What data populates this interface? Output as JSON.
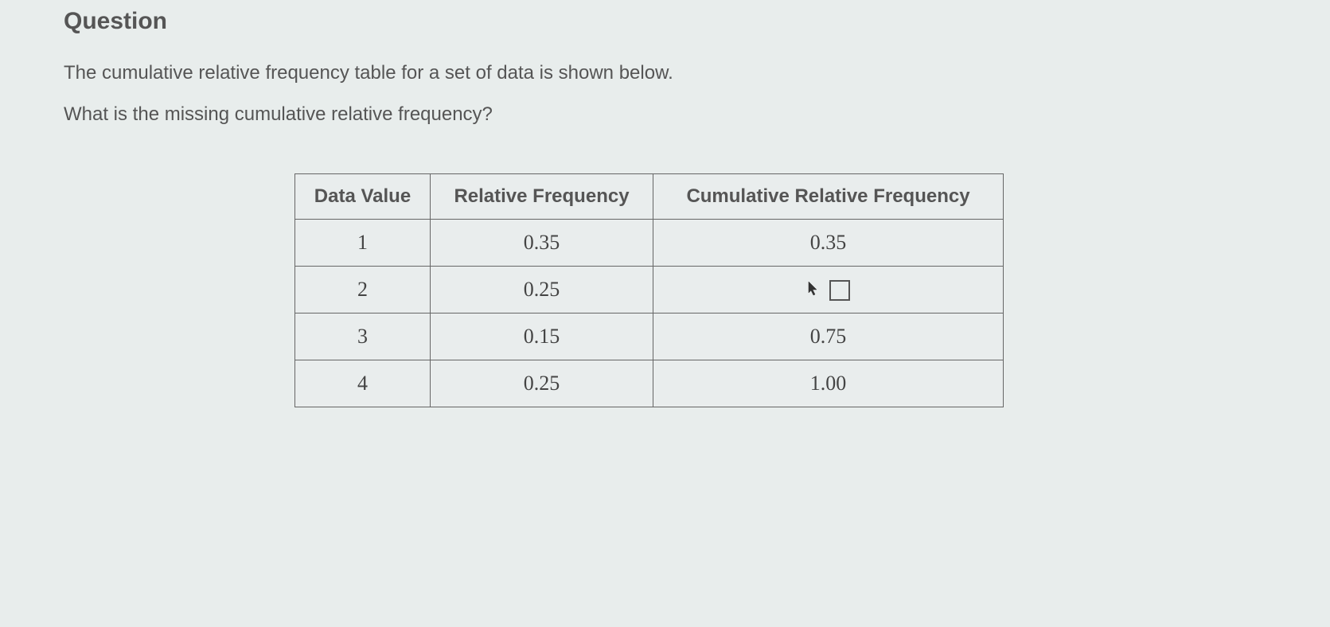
{
  "heading": "Question",
  "description": "The cumulative relative frequency table for a set of data is shown below.",
  "question_text": "What is the missing cumulative relative frequency?",
  "table": {
    "headers": {
      "data_value": "Data Value",
      "rel_freq": "Relative Frequency",
      "cum_rel_freq": "Cumulative Relative Frequency"
    },
    "rows": [
      {
        "data_value": "1",
        "rel_freq": "0.35",
        "cum_rel_freq": "0.35",
        "is_missing": false
      },
      {
        "data_value": "2",
        "rel_freq": "0.25",
        "cum_rel_freq": "",
        "is_missing": true
      },
      {
        "data_value": "3",
        "rel_freq": "0.15",
        "cum_rel_freq": "0.75",
        "is_missing": false
      },
      {
        "data_value": "4",
        "rel_freq": "0.25",
        "cum_rel_freq": "1.00",
        "is_missing": false
      }
    ]
  }
}
